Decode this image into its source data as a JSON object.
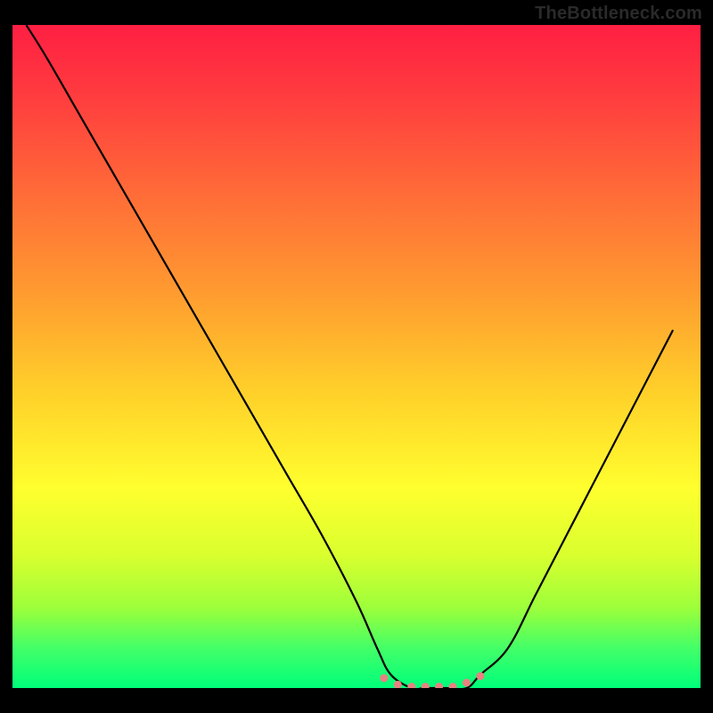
{
  "watermark": "TheBottleneck.com",
  "chart_data": {
    "type": "line",
    "title": "",
    "xlabel": "",
    "ylabel": "",
    "xlim": [
      0,
      100
    ],
    "ylim": [
      0,
      100
    ],
    "series": [
      {
        "name": "curve",
        "x": [
          2,
          5,
          10,
          15,
          20,
          25,
          30,
          35,
          40,
          45,
          50,
          53,
          55,
          58,
          60,
          63,
          66,
          68,
          72,
          76,
          80,
          84,
          88,
          92,
          96
        ],
        "y": [
          100,
          95,
          86,
          77,
          68,
          59,
          50,
          41,
          32,
          23,
          13,
          6,
          2,
          0,
          0,
          0,
          0,
          2,
          6,
          14,
          22,
          30,
          38,
          46,
          54
        ]
      }
    ],
    "markers": {
      "name": "bottom-dots",
      "x": [
        54,
        56,
        58,
        60,
        62,
        64,
        66,
        68
      ],
      "y": [
        1.5,
        0.5,
        0.2,
        0.2,
        0.2,
        0.2,
        0.8,
        1.8
      ],
      "color": "#e88181"
    },
    "gradient_stops": [
      {
        "offset": 0.0,
        "color": "#ff1f43"
      },
      {
        "offset": 0.1,
        "color": "#ff3a3f"
      },
      {
        "offset": 0.25,
        "color": "#ff6a38"
      },
      {
        "offset": 0.4,
        "color": "#ff9a30"
      },
      {
        "offset": 0.55,
        "color": "#ffcf2a"
      },
      {
        "offset": 0.7,
        "color": "#ffff2e"
      },
      {
        "offset": 0.8,
        "color": "#d9ff2e"
      },
      {
        "offset": 0.88,
        "color": "#9cff3b"
      },
      {
        "offset": 0.94,
        "color": "#43ff68"
      },
      {
        "offset": 1.0,
        "color": "#00ff7a"
      }
    ],
    "grid": false,
    "legend": false
  }
}
